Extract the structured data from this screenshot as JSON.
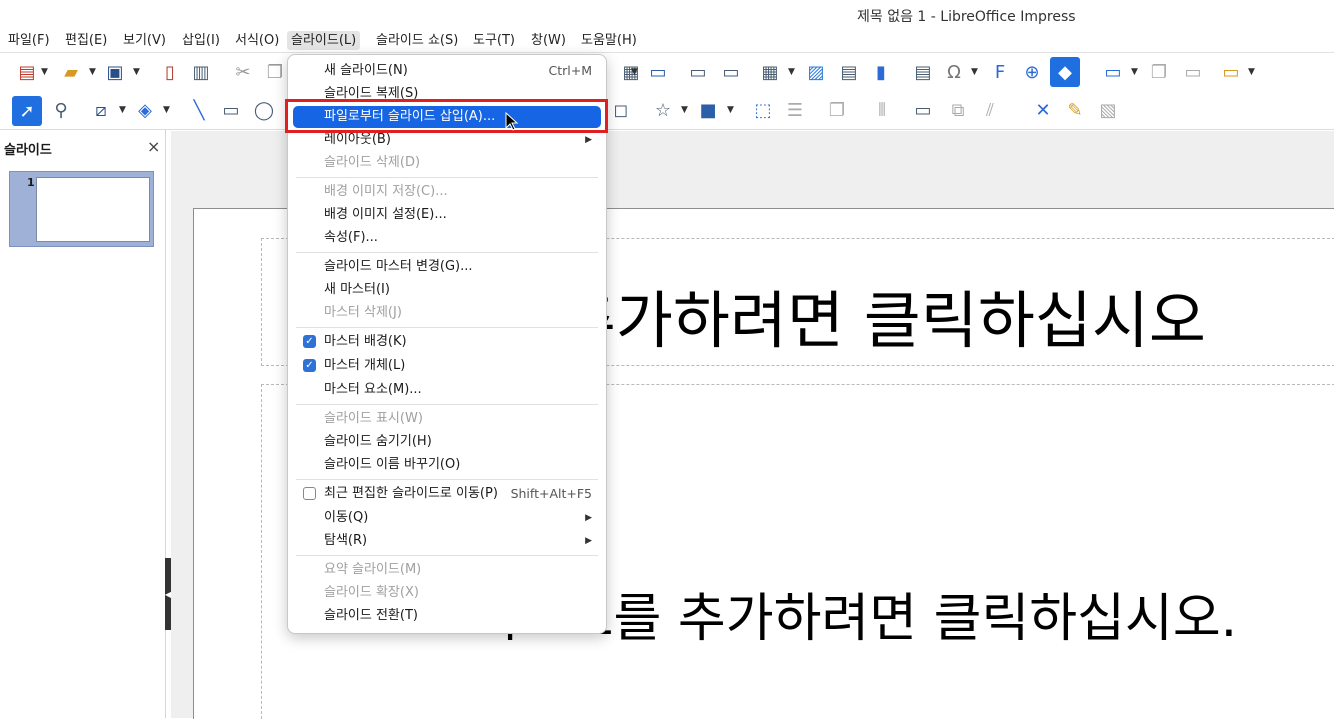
{
  "window": {
    "title": "제목 없음 1 - LibreOffice Impress"
  },
  "menubar": [
    {
      "label": "파일(F)"
    },
    {
      "label": "편집(E)"
    },
    {
      "label": "보기(V)"
    },
    {
      "label": "삽입(I)"
    },
    {
      "label": "서식(O)"
    },
    {
      "label": "슬라이드(L)",
      "active": true
    },
    {
      "label": "슬라이드 쇼(S)"
    },
    {
      "label": "도구(T)"
    },
    {
      "label": "창(W)"
    },
    {
      "label": "도움말(H)"
    }
  ],
  "sidebar": {
    "title": "슬라이드",
    "close": "×",
    "slides": [
      {
        "number": "1"
      }
    ]
  },
  "slide": {
    "title_placeholder": "제목을 추가하려면 클릭하십시오",
    "body_placeholder": "텍스트를 추가하려면 클릭하십시오."
  },
  "slide_menu": {
    "items": [
      {
        "label": "새 슬라이드(N)",
        "accel": "Ctrl+M"
      },
      {
        "label": "슬라이드 복제(S)"
      },
      {
        "label": "파일로부터 슬라이드 삽입(A)...",
        "highlighted": true
      },
      {
        "label": "레이아웃(B)",
        "submenu": true
      },
      {
        "label": "슬라이드 삭제(D)",
        "disabled": true
      },
      {
        "label": "배경 이미지 저장(C)...",
        "disabled": true
      },
      {
        "label": "배경 이미지 설정(E)..."
      },
      {
        "label": "속성(F)..."
      },
      {
        "label": "슬라이드 마스터 변경(G)..."
      },
      {
        "label": "새 마스터(I)"
      },
      {
        "label": "마스터 삭제(J)",
        "disabled": true
      },
      {
        "label": "마스터 배경(K)",
        "checked": true
      },
      {
        "label": "마스터 개체(L)",
        "checked": true
      },
      {
        "label": "마스터 요소(M)..."
      },
      {
        "label": "슬라이드 표시(W)",
        "disabled": true
      },
      {
        "label": "슬라이드 숨기기(H)"
      },
      {
        "label": "슬라이드 이름 바꾸기(O)"
      },
      {
        "label": "최근 편집한 슬라이드로 이동(P)",
        "accel": "Shift+Alt+F5",
        "checked": false
      },
      {
        "label": "이동(Q)",
        "submenu": true
      },
      {
        "label": "탐색(R)",
        "submenu": true
      },
      {
        "label": "요약 슬라이드(M)",
        "disabled": true
      },
      {
        "label": "슬라이드 확장(X)",
        "disabled": true
      },
      {
        "label": "슬라이드 전환(T)"
      }
    ],
    "submenu_arrow": "▶",
    "checkmark": "✓"
  },
  "toolbar1_icons": [
    "new-icon",
    "open-folder-icon",
    "save-icon",
    "export-pdf-icon",
    "print-icon",
    "cut-icon",
    "copy-icon",
    "paste-icon",
    "clone-formatting-icon",
    "undo-icon",
    "redo-icon",
    "find-replace-icon",
    "spelling-icon",
    "grid-icon",
    "display-views-icon",
    "master-slide-icon",
    "start-slideshow-icon",
    "start-current-icon",
    "table-icon",
    "image-icon",
    "media-icon",
    "chart-icon",
    "textbox-icon",
    "special-character-icon",
    "fontwork-icon",
    "hyperlink-icon",
    "interaction-icon",
    "new-slide-icon",
    "duplicate-slide-icon",
    "delete-slide-icon",
    "slide-layout-icon"
  ],
  "toolbar2_icons": [
    "select-icon",
    "zoom-icon",
    "line-color-icon",
    "fill-color-icon",
    "line-icon",
    "rectangle-icon",
    "ellipse-icon",
    "callout-icon",
    "star-icon",
    "3d-object-icon",
    "points-icon",
    "align-icon",
    "arrange-icon",
    "distribute-icon",
    "shadow-icon",
    "crop-icon",
    "filter-icon",
    "toggle-extrusion-icon",
    "glue-points-icon",
    "highlighter-icon",
    "show-gluepoint-icon"
  ],
  "accent_color": "#1565e4",
  "annotation_color": "#e02020"
}
